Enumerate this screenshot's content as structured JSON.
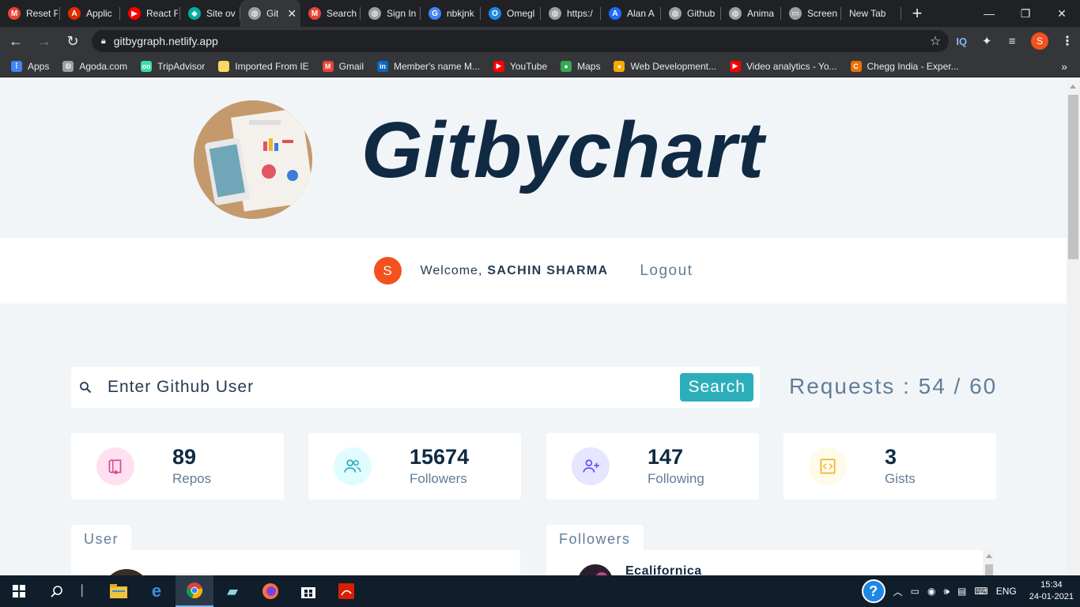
{
  "browser": {
    "tabs": [
      {
        "label": "Reset P",
        "icon": "gmail-icon",
        "color": "#ea4335",
        "glyph": "M"
      },
      {
        "label": "Applic",
        "icon": "angular-icon",
        "color": "#dd2c00",
        "glyph": "A"
      },
      {
        "label": "React F",
        "icon": "youtube-icon",
        "color": "#ff0000",
        "glyph": "▶"
      },
      {
        "label": "Site ov",
        "icon": "netlify-icon",
        "color": "#00ad9f",
        "glyph": "◆"
      },
      {
        "label": "Git",
        "icon": "globe-icon",
        "color": "#9aa0a6",
        "glyph": "◍",
        "active": true
      },
      {
        "label": "Search",
        "icon": "gmail-icon",
        "color": "#ea4335",
        "glyph": "M"
      },
      {
        "label": "Sign In",
        "icon": "globe-icon",
        "color": "#9aa0a6",
        "glyph": "◍"
      },
      {
        "label": "nbkjnk",
        "icon": "google-icon",
        "color": "#4285f4",
        "glyph": "G"
      },
      {
        "label": "Omegl",
        "icon": "omegle-icon",
        "color": "#1e88e5",
        "glyph": "O"
      },
      {
        "label": "https:/",
        "icon": "globe-icon",
        "color": "#9aa0a6",
        "glyph": "◍"
      },
      {
        "label": "Alan A",
        "icon": "alan-icon",
        "color": "#1e6bff",
        "glyph": "A"
      },
      {
        "label": "Github",
        "icon": "globe-icon",
        "color": "#9aa0a6",
        "glyph": "◍"
      },
      {
        "label": "Anima",
        "icon": "globe-icon",
        "color": "#9aa0a6",
        "glyph": "◍"
      },
      {
        "label": "Screen",
        "icon": "monitor-icon",
        "color": "#9aa0a6",
        "glyph": "▭"
      },
      {
        "label": "New Tab",
        "icon": "",
        "color": "transparent",
        "glyph": ""
      }
    ],
    "url": "gitbygraph.netlify.app",
    "extensions": [
      "IQ"
    ],
    "profile_initial": "S",
    "bookmarks": [
      {
        "label": "Apps",
        "color": "#4285f4",
        "glyph": "⋮"
      },
      {
        "label": "Agoda.com",
        "color": "#9aa0a6",
        "glyph": "◍"
      },
      {
        "label": "TripAdvisor",
        "color": "#34e0a1",
        "glyph": "oo"
      },
      {
        "label": "Imported From IE",
        "color": "#fdd663",
        "glyph": ""
      },
      {
        "label": "Gmail",
        "color": "#ea4335",
        "glyph": "M"
      },
      {
        "label": "Member's name M...",
        "color": "#0a66c2",
        "glyph": "in"
      },
      {
        "label": "YouTube",
        "color": "#ff0000",
        "glyph": "▶"
      },
      {
        "label": "Maps",
        "color": "#34a853",
        "glyph": "●"
      },
      {
        "label": "Web Development...",
        "color": "#f9ab00",
        "glyph": "●"
      },
      {
        "label": "Video analytics - Yo...",
        "color": "#ff0000",
        "glyph": "▶"
      },
      {
        "label": "Chegg India - Exper...",
        "color": "#eb7100",
        "glyph": "C"
      }
    ]
  },
  "page": {
    "title": "Gitbychart",
    "welcome": {
      "avatar_initial": "S",
      "greeting": "Welcome,",
      "user_name": "SACHIN SHARMA",
      "logout_label": "Logout"
    },
    "search": {
      "placeholder": "Enter Github User",
      "button_label": "Search",
      "requests_text": "Requests : 54 / 60"
    },
    "stats": [
      {
        "value": "89",
        "label": "Repos",
        "icon": "book-icon",
        "bg": "#ffe0f0",
        "fg": "#da4a91"
      },
      {
        "value": "15674",
        "label": "Followers",
        "icon": "users-icon",
        "bg": "#e0fcff",
        "fg": "#2caeba"
      },
      {
        "value": "147",
        "label": "Following",
        "icon": "user-plus-icon",
        "bg": "#e6e6ff",
        "fg": "#5d55fa"
      },
      {
        "value": "3",
        "label": "Gists",
        "icon": "code-icon",
        "bg": "#fffbea",
        "fg": "#f0b429"
      }
    ],
    "sections": {
      "user_tab": "User",
      "followers_tab": "Followers",
      "first_follower": "Ecalifornica"
    }
  },
  "taskbar": {
    "language": "ENG",
    "time": "15:34",
    "date": "24-01-2021"
  }
}
